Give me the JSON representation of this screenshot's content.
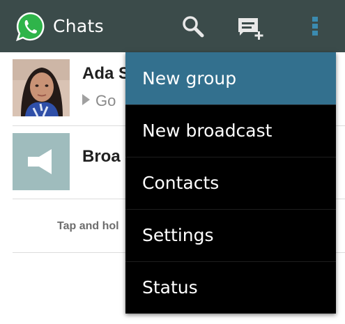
{
  "appbar": {
    "title": "Chats",
    "colors": {
      "bar": "#3b4b4a",
      "menu_selected": "#33708e",
      "menu_bg": "#000000",
      "logo_green": "#2fb44a"
    },
    "icons": [
      "whatsapp-logo-icon",
      "search-icon",
      "new-chat-icon",
      "overflow-menu-icon"
    ]
  },
  "chats": [
    {
      "name": "Ada S",
      "preview": "Go",
      "avatar": "contact-photo"
    },
    {
      "name": "Broa",
      "preview": "",
      "avatar": "broadcast-icon"
    }
  ],
  "hint": "Tap and hol",
  "menu": {
    "items": [
      {
        "label": "New group",
        "selected": true
      },
      {
        "label": "New broadcast",
        "selected": false
      },
      {
        "label": "Contacts",
        "selected": false
      },
      {
        "label": "Settings",
        "selected": false
      },
      {
        "label": "Status",
        "selected": false
      }
    ]
  }
}
